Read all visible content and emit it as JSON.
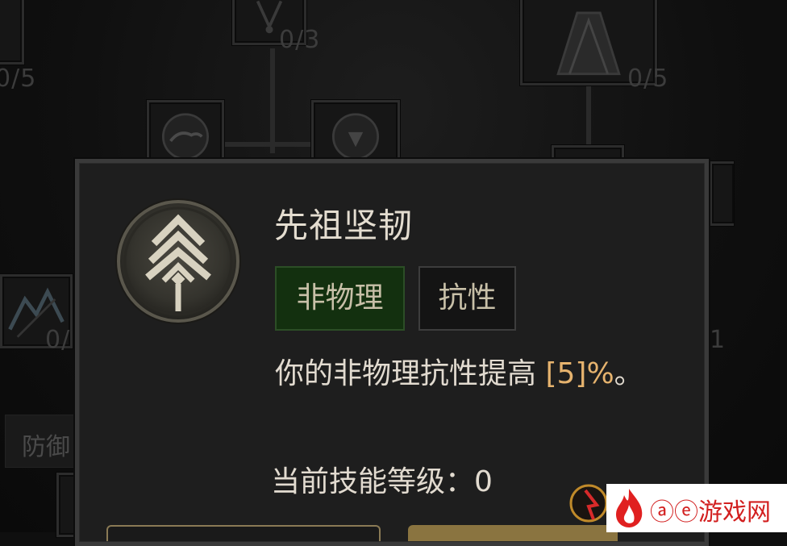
{
  "background": {
    "counts": [
      "0/5",
      "0/3",
      "0/5",
      "0/",
      "1"
    ],
    "side_label": "防御"
  },
  "tooltip": {
    "title": "先祖坚韧",
    "icon": "ancestral-chevron-icon",
    "tags": [
      "非物理",
      "抗性"
    ],
    "description_prefix": "你的非物理抗性提高 ",
    "description_value": "[5]%",
    "description_suffix": "。",
    "level_text": "当前技能等级：0"
  },
  "watermark": {
    "text": "ⓐⓔ游戏网"
  },
  "colors": {
    "panel_bg": "#1e1e1e",
    "tag_green": "#13300f",
    "value_highlight": "#e6b36e",
    "watermark_red": "#d21f1f"
  }
}
